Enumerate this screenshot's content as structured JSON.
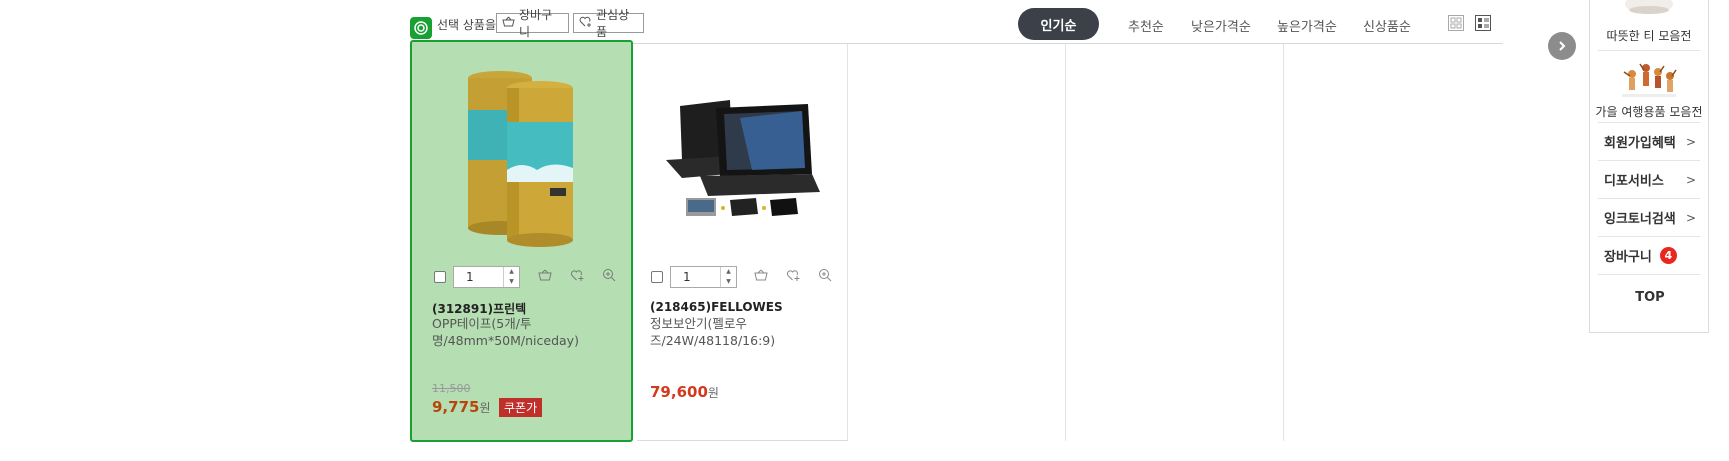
{
  "toolbar": {
    "selected_label": "선택 상품을",
    "cart_button": "장바구니",
    "wishlist_button": "관심상품"
  },
  "sort": {
    "active": "인기순",
    "options": [
      "추천순",
      "낮은가격순",
      "높은가격순",
      "신상품순"
    ]
  },
  "products": [
    {
      "code": "(312891)프린텍",
      "name": "OPP테이프(5개/투명/48mm*50M/niceday)",
      "quantity": "1",
      "original_price": "11,500",
      "price": "9,775",
      "currency": "원",
      "badge": "쿠폰가",
      "selected": true
    },
    {
      "code": "(218465)FELLOWES",
      "name": "정보보안기(펠로우즈/24W/48118/16:9)",
      "quantity": "1",
      "price": "79,600",
      "currency": "원",
      "selected": false
    }
  ],
  "sidebar": {
    "promos": [
      "따뜻한 티 모음전",
      "가을 여행용품 모음전"
    ],
    "links": [
      "회원가입혜택",
      "디포서비스",
      "잉크토너검색"
    ],
    "cart_label": "장바구니",
    "cart_count": "4",
    "top_label": "TOP"
  },
  "colors": {
    "selected_bg": "#b5deb3",
    "selected_border": "#18a033",
    "sort_active_bg": "#3c4049",
    "price_red": "#d23a1e",
    "coupon_badge": "#c0302b",
    "cart_badge": "#e8281e"
  },
  "icons": [
    "basket-icon",
    "heart-plus-icon",
    "zoom-icon",
    "grid-view-icon",
    "list-view-icon",
    "chevron-right-icon",
    "selected-check-icon"
  ]
}
